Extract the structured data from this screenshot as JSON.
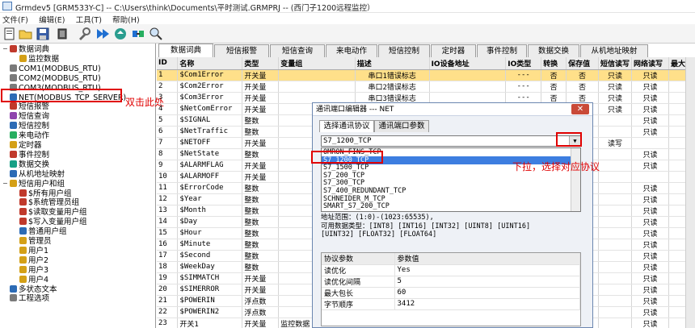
{
  "window": {
    "title": "Grmdev5 [GRM533Y-C]  -- C:\\Users\\think\\Documents\\平时测试.GRMPRJ  -- (西门子1200远程监控）"
  },
  "menu": [
    "文件(F)",
    "编辑(E)",
    "工具(T)",
    "帮助(H)"
  ],
  "toolbar": [
    "new-icon",
    "open-icon",
    "save-icon",
    "chip-icon",
    "wrench-icon",
    "download-icon",
    "upload-icon",
    "connect-icon",
    "monitor-icon",
    "search-icon"
  ],
  "tree": [
    {
      "label": "数据词典",
      "indent": 0,
      "exp": "−",
      "color": "#c0392b"
    },
    {
      "label": "监控数据",
      "indent": 1,
      "exp": "",
      "color": "#d4a017"
    },
    {
      "label": "COM1(MODBUS_RTU)",
      "indent": 0,
      "exp": "",
      "color": "#7a7a7a"
    },
    {
      "label": "COM2(MODBUS_RTU)",
      "indent": 0,
      "exp": "",
      "color": "#7a7a7a"
    },
    {
      "label": "COM3(MODBUS_RTU)",
      "indent": 0,
      "exp": "",
      "color": "#7a7a7a"
    },
    {
      "label": "NET(MODBUS_TCP_SERVER)",
      "indent": 0,
      "exp": "",
      "color": "#2c6bb5"
    },
    {
      "label": "短信报警",
      "indent": 0,
      "exp": "",
      "color": "#c0392b"
    },
    {
      "label": "短信查询",
      "indent": 0,
      "exp": "",
      "color": "#8e44ad"
    },
    {
      "label": "短信控制",
      "indent": 0,
      "exp": "",
      "color": "#2c6bb5"
    },
    {
      "label": "来电动作",
      "indent": 0,
      "exp": "",
      "color": "#27ae60"
    },
    {
      "label": "定时器",
      "indent": 0,
      "exp": "",
      "color": "#d4a017"
    },
    {
      "label": "事件控制",
      "indent": 0,
      "exp": "",
      "color": "#c0392b"
    },
    {
      "label": "数据交换",
      "indent": 0,
      "exp": "",
      "color": "#16a085"
    },
    {
      "label": "从机地址映射",
      "indent": 0,
      "exp": "",
      "color": "#2c6bb5"
    },
    {
      "label": "短信用户和组",
      "indent": 0,
      "exp": "−",
      "color": "#d4a017"
    },
    {
      "label": "$所有用户组",
      "indent": 1,
      "exp": "",
      "color": "#c0392b"
    },
    {
      "label": "$系统管理员组",
      "indent": 1,
      "exp": "",
      "color": "#c0392b"
    },
    {
      "label": "$读取变量用户组",
      "indent": 1,
      "exp": "",
      "color": "#c0392b"
    },
    {
      "label": "$写入变量用户组",
      "indent": 1,
      "exp": "",
      "color": "#c0392b"
    },
    {
      "label": "普通用户组",
      "indent": 1,
      "exp": "",
      "color": "#2c6bb5"
    },
    {
      "label": "管理员",
      "indent": 1,
      "exp": "",
      "color": "#d4a017"
    },
    {
      "label": "用户1",
      "indent": 1,
      "exp": "",
      "color": "#d4a017"
    },
    {
      "label": "用户2",
      "indent": 1,
      "exp": "",
      "color": "#d4a017"
    },
    {
      "label": "用户3",
      "indent": 1,
      "exp": "",
      "color": "#d4a017"
    },
    {
      "label": "用户4",
      "indent": 1,
      "exp": "",
      "color": "#d4a017"
    },
    {
      "label": "多状态文本",
      "indent": 0,
      "exp": "",
      "color": "#2c6bb5"
    },
    {
      "label": "工程选项",
      "indent": 0,
      "exp": "",
      "color": "#7a7a7a"
    }
  ],
  "tabs": [
    "数据词典",
    "短信报警",
    "短信查询",
    "来电动作",
    "短信控制",
    "定时器",
    "事件控制",
    "数据交换",
    "从机地址映射"
  ],
  "columns": [
    "ID",
    "名称",
    "类型",
    "变量组",
    "描述",
    "IO设备地址",
    "IO类型",
    "转换",
    "保存值",
    "短信读写",
    "网络读写",
    "最大"
  ],
  "rows": [
    [
      "1",
      "$Com1Error",
      "开关量",
      "",
      "串口1错误标志",
      "",
      "---",
      "否",
      "否",
      "只读",
      "只读",
      ""
    ],
    [
      "2",
      "$Com2Error",
      "开关量",
      "",
      "串口2错误标志",
      "",
      "---",
      "否",
      "否",
      "只读",
      "只读",
      ""
    ],
    [
      "3",
      "$Com3Error",
      "开关量",
      "",
      "串口3错误标志",
      "",
      "---",
      "否",
      "否",
      "只读",
      "只读",
      ""
    ],
    [
      "4",
      "$NetComError",
      "开关量",
      "",
      "",
      "",
      "",
      "",
      "",
      "只读",
      "只读",
      ""
    ],
    [
      "5",
      "$SIGNAL",
      "整数",
      "",
      "",
      "",
      "",
      "",
      "",
      "",
      "只读",
      ""
    ],
    [
      "6",
      "$NetTraffic",
      "整数",
      "",
      "",
      "",
      "",
      "",
      "",
      "",
      "只读",
      ""
    ],
    [
      "7",
      "$NETOFF",
      "开关量",
      "",
      "",
      "",
      "",
      "",
      "",
      "读写",
      "",
      ""
    ],
    [
      "8",
      "$NetState",
      "整数",
      "",
      "",
      "",
      "",
      "",
      "",
      "",
      "只读",
      ""
    ],
    [
      "9",
      "$ALARMFLAG",
      "开关量",
      "",
      "",
      "",
      "",
      "",
      "",
      "",
      "只读",
      ""
    ],
    [
      "10",
      "$ALARMOFF",
      "开关量",
      "",
      "",
      "",
      "",
      "",
      "",
      "",
      "",
      ""
    ],
    [
      "11",
      "$ErrorCode",
      "整数",
      "",
      "",
      "",
      "",
      "",
      "",
      "",
      "只读",
      ""
    ],
    [
      "12",
      "$Year",
      "整数",
      "",
      "",
      "",
      "",
      "",
      "",
      "",
      "只读",
      ""
    ],
    [
      "13",
      "$Month",
      "整数",
      "",
      "",
      "",
      "",
      "",
      "",
      "",
      "只读",
      ""
    ],
    [
      "14",
      "$Day",
      "整数",
      "",
      "",
      "",
      "",
      "",
      "",
      "",
      "只读",
      ""
    ],
    [
      "15",
      "$Hour",
      "整数",
      "",
      "",
      "",
      "",
      "",
      "",
      "",
      "只读",
      ""
    ],
    [
      "16",
      "$Minute",
      "整数",
      "",
      "",
      "",
      "",
      "",
      "",
      "",
      "只读",
      ""
    ],
    [
      "17",
      "$Second",
      "整数",
      "",
      "",
      "",
      "",
      "",
      "",
      "",
      "只读",
      ""
    ],
    [
      "18",
      "$WeekDay",
      "整数",
      "",
      "",
      "",
      "",
      "",
      "",
      "",
      "只读",
      ""
    ],
    [
      "19",
      "$SIMMATCH",
      "开关量",
      "",
      "",
      "",
      "",
      "",
      "",
      "",
      "只读",
      ""
    ],
    [
      "20",
      "$SIMERROR",
      "开关量",
      "",
      "",
      "",
      "",
      "",
      "",
      "",
      "只读",
      ""
    ],
    [
      "21",
      "$POWERIN",
      "浮点数",
      "",
      "",
      "",
      "",
      "",
      "",
      "",
      "只读",
      ""
    ],
    [
      "22",
      "$POWERIN2",
      "浮点数",
      "",
      "",
      "",
      "",
      "",
      "",
      "",
      "只读",
      ""
    ],
    [
      "23",
      "开关1",
      "开关量",
      "监控数据",
      "",
      "",
      "",
      "",
      "",
      "",
      "只读",
      ""
    ]
  ],
  "annotations": {
    "double_click": "双击此处",
    "pulldown": "下拉，选择对应协议"
  },
  "dialog": {
    "title": "通讯端口编辑器 --- NET",
    "close": "✕",
    "tab1": "选择通讯协议",
    "tab2": "通讯端口参数",
    "selected": "S7_1200_TCP",
    "options": [
      "OMRON_FINS_TCP",
      "S7_1200_TCP",
      "S7_1500_TCP",
      "S7_200_TCP",
      "S7_300_TCP",
      "S7_400_REDUNDANT_TCP",
      "SCHNEIDER_M_TCP",
      "SMART_S7_200_TCP"
    ],
    "desc1": "地址范围：(1:0)-(1023:65535),",
    "desc2": "可用数据类型：[INT8] [INT16] [INT32] [UINT8] [UINT16]",
    "desc3": "[UINT32] [FLOAT32] [FLOAT64]",
    "param_header": [
      "协议参数",
      "参数值"
    ],
    "params": [
      [
        "读优化",
        "Yes"
      ],
      [
        "读优化间隔",
        "5"
      ],
      [
        "最大包长",
        "60"
      ],
      [
        "字节顺序",
        "3412"
      ]
    ]
  }
}
